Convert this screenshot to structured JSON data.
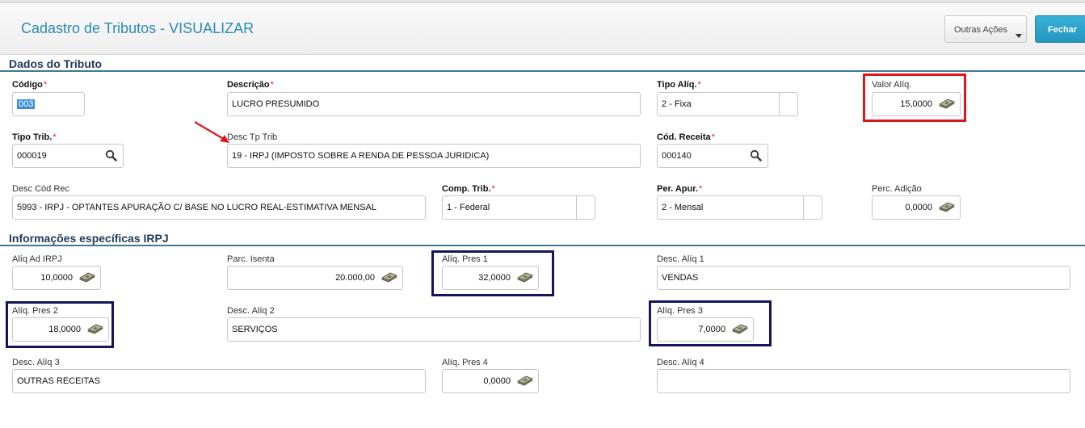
{
  "header": {
    "title": "Cadastro de Tributos - VISUALIZAR",
    "other_actions_label": "Outras Ações",
    "close_label": "Fechar"
  },
  "sections": {
    "dados": "Dados do Tributo",
    "irpj": "Informações específicas IRPJ"
  },
  "fields": {
    "codigo": {
      "label": "Código",
      "value": "003"
    },
    "descricao": {
      "label": "Descrição",
      "value": "LUCRO PRESUMIDO"
    },
    "tipo_aliq": {
      "label": "Tipo Alíq.",
      "value": "2 - Fixa"
    },
    "valor_aliq": {
      "label": "Valor Alíq.",
      "value": "15,0000"
    },
    "tipo_trib": {
      "label": "Tipo Trib.",
      "value": "000019"
    },
    "desc_tp_trib": {
      "label": "Desc Tp Trib",
      "value": "19 - IRPJ (IMPOSTO SOBRE A RENDA DE PESSOA JURIDICA)"
    },
    "cod_receita": {
      "label": "Cód. Receita",
      "value": "000140"
    },
    "desc_cod_rec": {
      "label": "Desc Cód Rec",
      "value": "5993 - IRPJ - OPTANTES APURAÇÃO C/ BASE NO LUCRO REAL-ESTIMATIVA MENSAL"
    },
    "comp_trib": {
      "label": "Comp. Trib.",
      "value": "1 - Federal"
    },
    "per_apur": {
      "label": "Per. Apur.",
      "value": "2 - Mensal"
    },
    "perc_adicao": {
      "label": "Perc. Adição",
      "value": "0,0000"
    },
    "aliq_ad_irpj": {
      "label": "Alíq Ad IRPJ",
      "value": "10,0000"
    },
    "parc_isenta": {
      "label": "Parc. Isenta",
      "value": "20.000,00"
    },
    "aliq_pres_1": {
      "label": "Alíq. Pres 1",
      "value": "32,0000"
    },
    "desc_aliq_1": {
      "label": "Desc. Alíq 1",
      "value": "VENDAS"
    },
    "aliq_pres_2": {
      "label": "Alíq. Pres 2",
      "value": "18,0000"
    },
    "desc_aliq_2": {
      "label": "Desc. Alíq 2",
      "value": "SERVIÇOS"
    },
    "aliq_pres_3": {
      "label": "Alíq. Pres 3",
      "value": "7,0000"
    },
    "desc_aliq_3": {
      "label": "Desc. Alíq 3",
      "value": "OUTRAS RECEITAS"
    },
    "aliq_pres_4": {
      "label": "Alíq. Pres 4",
      "value": "0,0000"
    },
    "desc_aliq_4": {
      "label": "Desc. Alíq 4",
      "value": ""
    }
  },
  "icons": {
    "money": "money-icon",
    "search": "search-icon",
    "dropdown": "caret-down-icon"
  },
  "colors": {
    "title": "#2c8bb6",
    "primary_button": "#2496c0",
    "required_star": "#d9262b",
    "highlight_red": "#e0161d",
    "highlight_blue": "#15155e",
    "section_line": "#3e7896"
  }
}
